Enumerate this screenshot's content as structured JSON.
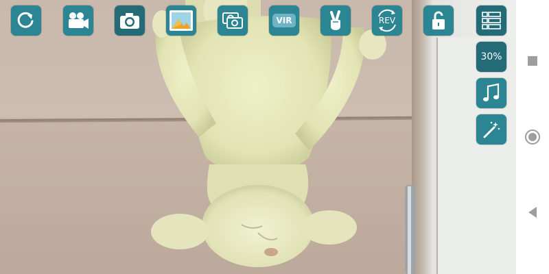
{
  "toolbar": {
    "top": [
      {
        "name": "refresh-button",
        "icon": "refresh-icon"
      },
      {
        "name": "record-video-button",
        "icon": "video-camera-icon"
      },
      {
        "name": "take-photo-button",
        "icon": "camera-icon"
      },
      {
        "name": "gallery-button",
        "icon": "image-icon"
      },
      {
        "name": "dual-camera-button",
        "icon": "dual-camera-icon"
      },
      {
        "name": "vr-button",
        "icon": "vr-icon",
        "label": "VIR"
      },
      {
        "name": "gesture-button",
        "icon": "victory-hand-icon"
      },
      {
        "name": "reverse-button",
        "icon": "reverse-icon",
        "label": "REV"
      },
      {
        "name": "lock-button",
        "icon": "unlock-icon"
      },
      {
        "name": "menu-button",
        "icon": "list-menu-icon"
      }
    ],
    "side": [
      {
        "name": "zoom-level-button",
        "label": "30%"
      },
      {
        "name": "music-button",
        "icon": "music-note-icon"
      },
      {
        "name": "effects-button",
        "icon": "magic-wand-icon"
      }
    ]
  },
  "colors": {
    "button_bg": "#2c8592",
    "button_dark_bg": "#226b77",
    "icon_fg": "#ffffff"
  },
  "navbar": {
    "items": [
      {
        "name": "nav-recents-button",
        "icon": "square-icon"
      },
      {
        "name": "nav-home-button",
        "icon": "circle-icon"
      },
      {
        "name": "nav-back-button",
        "icon": "triangle-back-icon"
      }
    ]
  }
}
